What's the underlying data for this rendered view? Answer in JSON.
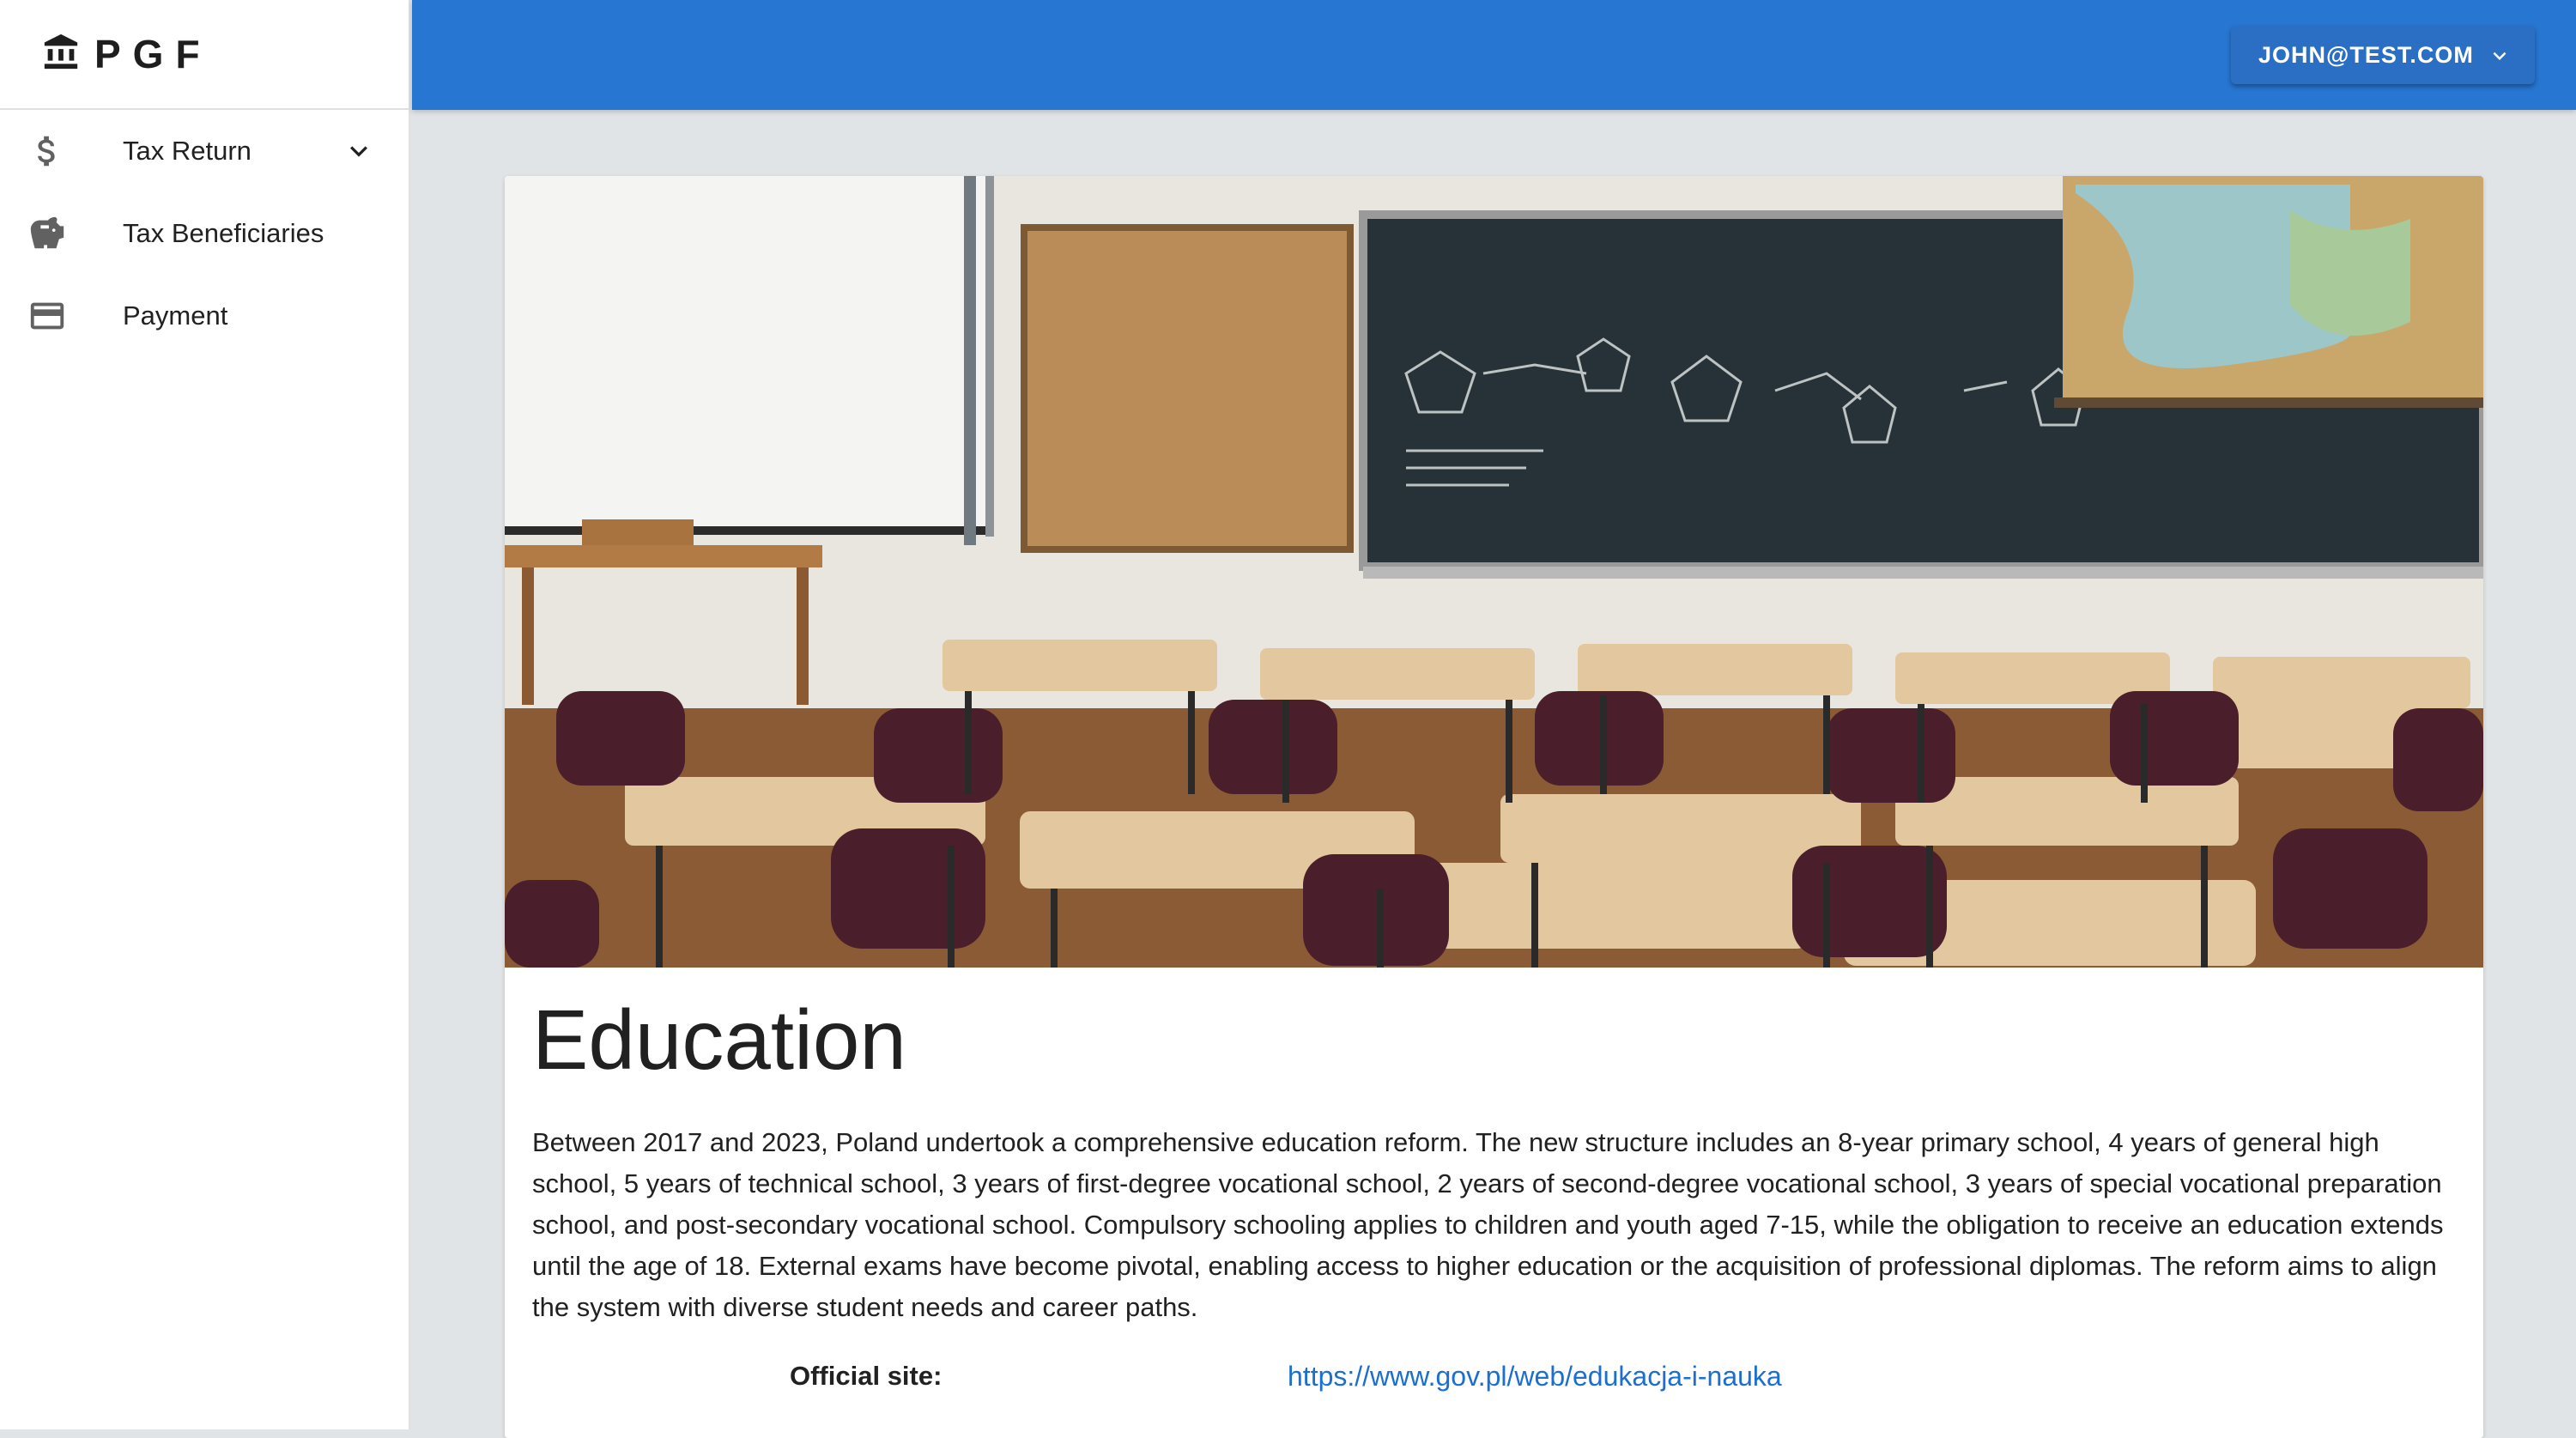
{
  "brand": {
    "name": "PGF",
    "icon": "bank-icon"
  },
  "sidebar": {
    "items": [
      {
        "label": "Tax Return",
        "icon": "dollar-icon",
        "expandable": true
      },
      {
        "label": "Tax Beneficiaries",
        "icon": "piggy-bank-icon",
        "expandable": false
      },
      {
        "label": "Payment",
        "icon": "credit-card-icon",
        "expandable": false
      }
    ]
  },
  "header": {
    "user_email": "JOHN@TEST.COM",
    "accent_color": "#2776d2"
  },
  "main": {
    "hero_image": "classroom-photo",
    "title": "Education",
    "description": "Between 2017 and 2023, Poland undertook a comprehensive education reform. The new structure includes an 8-year primary school, 4 years of general high school, 5 years of technical school, 3 years of first-degree vocational school, 2 years of second-degree vocational school, 3 years of special vocational preparation school, and post-secondary vocational school. Compulsory schooling applies to children and youth aged 7-15, while the obligation to receive an education extends until the age of 18. External exams have become pivotal, enabling access to higher education or the acquisition of professional diplomas. The reform aims to align the system with diverse student needs and career paths.",
    "official_site_label": "Official site:",
    "official_site_url": "https://www.gov.pl/web/edukacja-i-nauka"
  }
}
